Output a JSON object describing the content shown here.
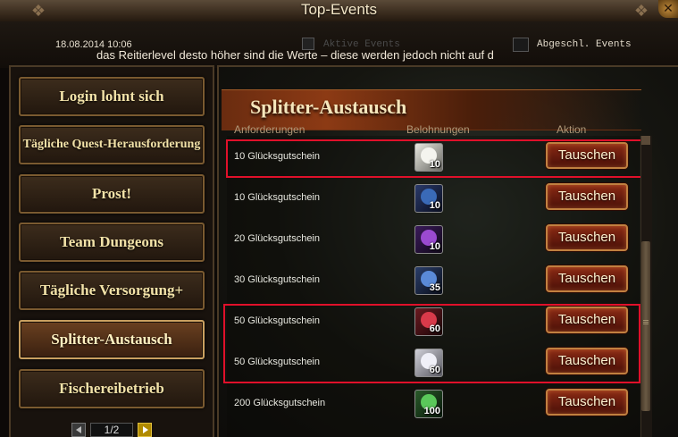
{
  "window": {
    "title": "Top-Events",
    "close_symbol": "✕"
  },
  "header": {
    "datetime": "18.08.2014 10:06",
    "marquee": "das Reitierlevel desto höher sind die Werte – diese werden jedoch nicht auf d",
    "tab_faded_label": "Aktive Events",
    "tab_completed_label": "Abgeschl. Events"
  },
  "sidebar": {
    "items": [
      {
        "label": "Login lohnt sich"
      },
      {
        "label": "Tägliche Quest-Herausforderung"
      },
      {
        "label": "Prost!"
      },
      {
        "label": "Team Dungeons"
      },
      {
        "label": "Tägliche Versorgung+"
      },
      {
        "label": "Splitter-Austausch"
      },
      {
        "label": "Fischereibetrieb"
      }
    ],
    "active_index": 5,
    "pager": {
      "value": "1/2"
    }
  },
  "main": {
    "banner_title": "Splitter-Austausch",
    "columns": [
      "Anforderungen",
      "Belohnungen",
      "Aktion"
    ],
    "rows": [
      {
        "requirement": "10 Glücksgutschein",
        "qty": "10",
        "icon": "white-gear-crystal-icon",
        "color": "#c8c8c0",
        "button": "Tauschen"
      },
      {
        "requirement": "10 Glücksgutschein",
        "qty": "10",
        "icon": "blue-steed-icon",
        "color": "#3a6ab8",
        "button": "Tauschen"
      },
      {
        "requirement": "20 Glücksgutschein",
        "qty": "10",
        "icon": "purple-orb-icon",
        "color": "#7a3ab0",
        "button": "Tauschen"
      },
      {
        "requirement": "30 Glücksgutschein",
        "qty": "35",
        "icon": "blue-beast-icon",
        "color": "#4a7ac8",
        "button": "Tauschen"
      },
      {
        "requirement": "50 Glücksgutschein",
        "qty": "60",
        "icon": "red-flame-icon",
        "color": "#c82a3a",
        "button": "Tauschen"
      },
      {
        "requirement": "50 Glücksgutschein",
        "qty": "60",
        "icon": "white-spirit-icon",
        "color": "#e0e0e8",
        "button": "Tauschen"
      },
      {
        "requirement": "200 Glücksgutschein",
        "qty": "100",
        "icon": "green-wings-icon",
        "color": "#4ab84a",
        "button": "Tauschen"
      }
    ]
  },
  "colors": {
    "highlight": "#e0102a",
    "button": "#8a2a14",
    "label": "#f2e2a8"
  }
}
